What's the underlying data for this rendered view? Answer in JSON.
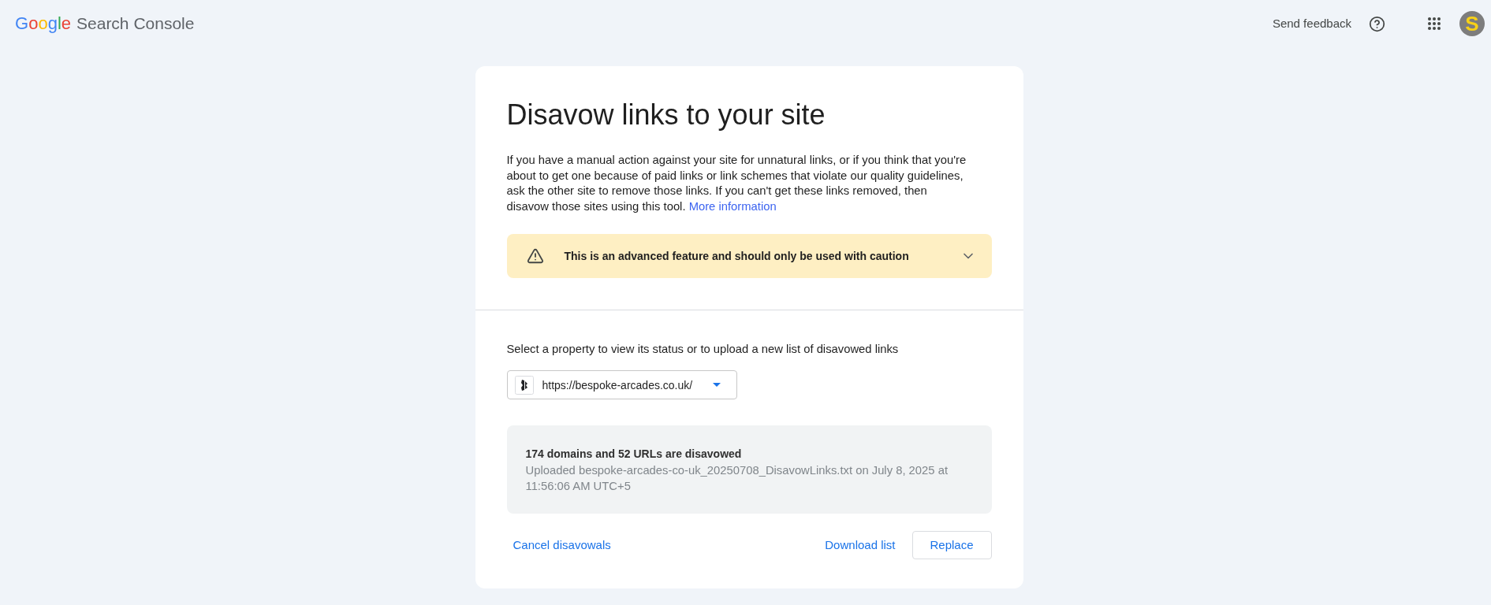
{
  "header": {
    "logo": {
      "brand": "Google",
      "product": "Search Console"
    },
    "send_feedback": "Send feedback",
    "avatar": {
      "letter": "S"
    }
  },
  "card": {
    "title": "Disavow links to your site",
    "intro": {
      "text": "If you have a manual action against your site for unnatural links, or if you think that you're about to get one because of paid links or link schemes that violate our quality guidelines, ask the other site to remove those links. If you can't get these links removed, then disavow those sites using this tool.",
      "link": "More information"
    },
    "warning": {
      "text": "This is an advanced feature and should only be used with caution",
      "expanded": false
    },
    "property_prompt": "Select a property to view its status or to upload a new list of disavowed links",
    "property_select": {
      "value": "https://bespoke-arcades.co.uk/"
    },
    "status": {
      "headline": "174 domains and 52 URLs are disavowed",
      "details": "Uploaded bespoke-arcades-co-uk_20250708_DisavowLinks.txt on July 8, 2025 at 11:56:06 AM UTC+5"
    },
    "actions": {
      "left": [
        {
          "label": "Cancel disavowals",
          "kind": "text"
        }
      ],
      "right": [
        {
          "label": "Download list",
          "kind": "text"
        },
        {
          "label": "Replace",
          "kind": "outlined"
        }
      ]
    }
  }
}
